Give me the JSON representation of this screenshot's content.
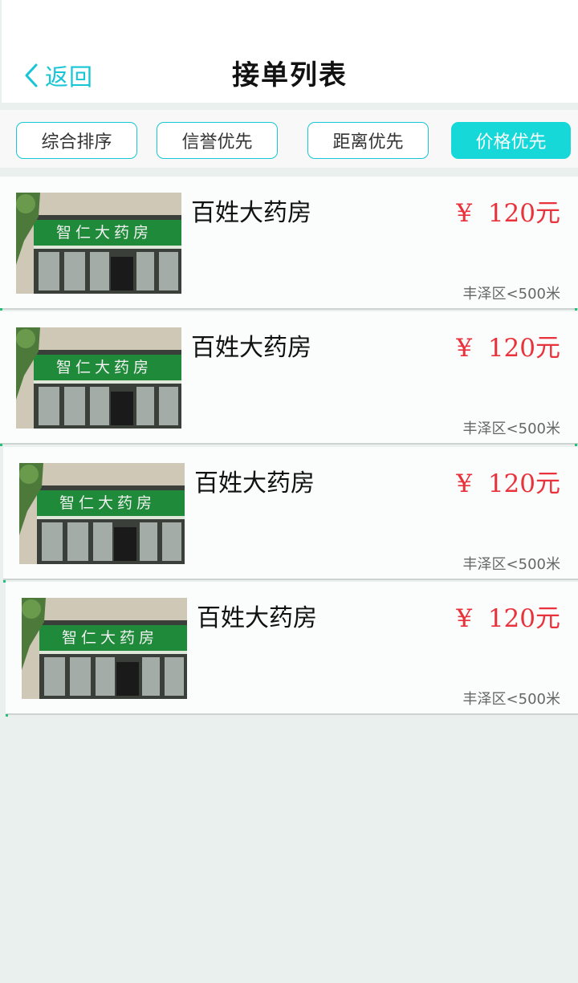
{
  "header": {
    "back_label": "返回",
    "title": "接单列表"
  },
  "filters": [
    {
      "label": "综合排序",
      "active": false
    },
    {
      "label": "信誉优先",
      "active": false
    },
    {
      "label": "距离优先",
      "active": false
    },
    {
      "label": "价格优先",
      "active": true
    }
  ],
  "items": [
    {
      "name": "百姓大药房",
      "price": "¥  120元",
      "location": "丰泽区<500米",
      "sign_text": "智仁大药房"
    },
    {
      "name": "百姓大药房",
      "price": "¥  120元",
      "location": "丰泽区<500米",
      "sign_text": "智仁大药房"
    },
    {
      "name": "百姓大药房",
      "price": "¥  120元",
      "location": "丰泽区<500米",
      "sign_text": "智仁大药房"
    },
    {
      "name": "百姓大药房",
      "price": "¥  120元",
      "location": "丰泽区<500米",
      "sign_text": "智仁大药房"
    }
  ],
  "colors": {
    "accent": "#16c6d6",
    "price": "#e8323c",
    "background": "#eaf0ed"
  }
}
